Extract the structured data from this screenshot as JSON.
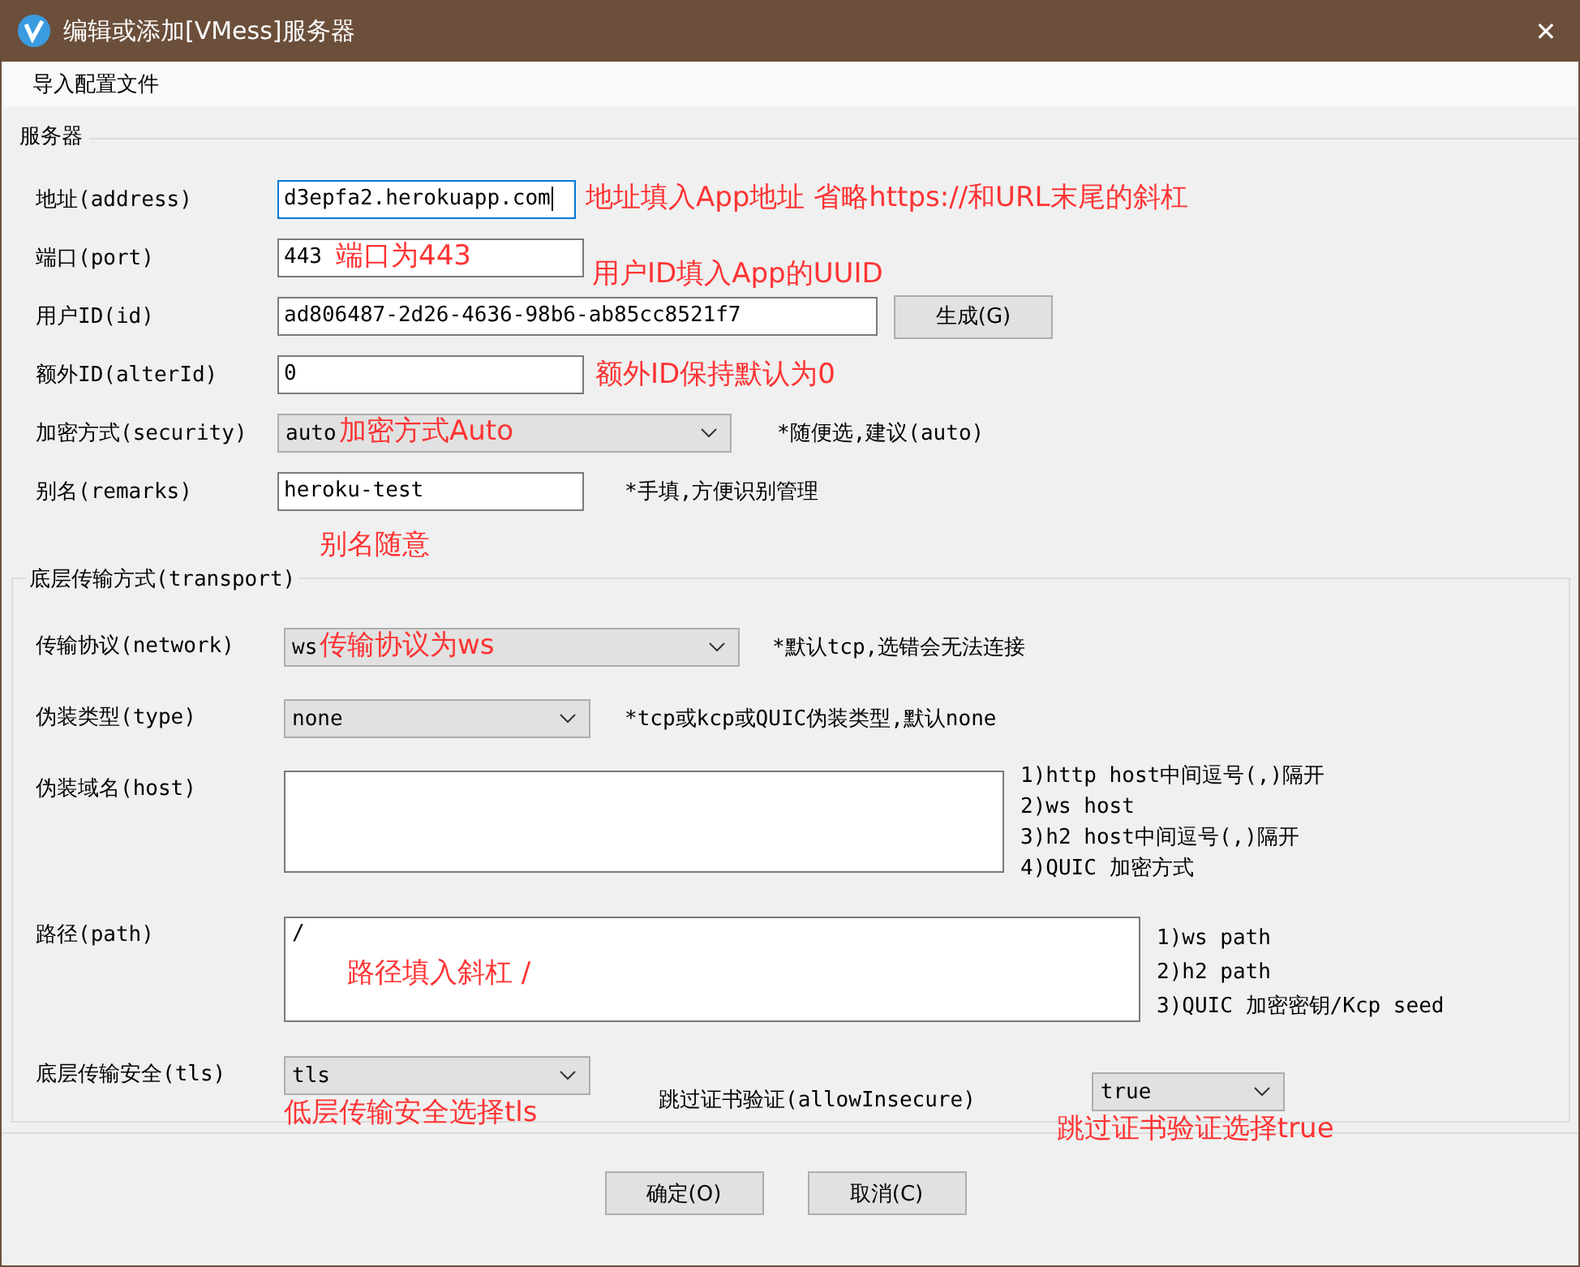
{
  "window": {
    "title": "编辑或添加[VMess]服务器",
    "close": "✕"
  },
  "menu": [
    "导入配置文件"
  ],
  "server": {
    "title": "服务器",
    "fields": [
      {
        "label": "地址(address)",
        "kind": "text",
        "value": "d3epfa2.herokuapp.com",
        "focused": true,
        "annotation": "地址填入App地址 省略https://和URL末尾的斜杠"
      },
      {
        "label": "端口(port)",
        "kind": "text",
        "value": "443",
        "focused": false,
        "annotation": "端口为443"
      },
      {
        "label": "用户ID(id)",
        "kind": "text",
        "value": "ad806487-2d26-4636-98b6-ab85cc8521f7",
        "focused": false,
        "annotation": "用户ID填入App的UUID",
        "button": "生成(G)"
      },
      {
        "label": "额外ID(alterId)",
        "kind": "text",
        "value": "0",
        "focused": false,
        "annotation": "额外ID保持默认为0"
      },
      {
        "label": "加密方式(security)",
        "kind": "select",
        "value": "auto",
        "annotation": "加密方式Auto",
        "hint": "*随便选,建议(auto)"
      },
      {
        "label": "别名(remarks)",
        "kind": "text",
        "value": "heroku-test",
        "focused": false,
        "annotation": "别名随意",
        "hint": "*手填,方便识别管理"
      }
    ]
  },
  "transport": {
    "title": "底层传输方式(transport)",
    "fields": [
      {
        "label": "传输协议(network)",
        "kind": "select",
        "value": "ws",
        "annotation": "传输协议为ws",
        "hints": [
          "*默认tcp,选错会无法连接"
        ]
      },
      {
        "label": "伪装类型(type)",
        "kind": "select",
        "value": "none",
        "hints": [
          "*tcp或kcp或QUIC伪装类型,默认none"
        ]
      },
      {
        "label": "伪装域名(host)",
        "kind": "textarea",
        "hints": [
          "1)http host中间逗号(,)隔开",
          "2)ws host",
          "3)h2 host中间逗号(,)隔开",
          "4)QUIC 加密方式"
        ]
      },
      {
        "label": "路径(path)",
        "kind": "textarea",
        "value": "/",
        "annotation": "路径填入斜杠 /",
        "hints": [
          "1)ws path",
          "2)h2 path",
          "3)QUIC 加密密钥/Kcp seed"
        ]
      },
      {
        "label": "底层传输安全(tls)",
        "kind": "select",
        "value": "tls",
        "annotation": "低层传输安全选择tls",
        "extra": {
          "label": "跳过证书验证(allowInsecure)",
          "value": "true",
          "annotation": "跳过证书验证选择true"
        }
      }
    ]
  },
  "buttons": [
    "确定(O)",
    "取消(C)"
  ]
}
